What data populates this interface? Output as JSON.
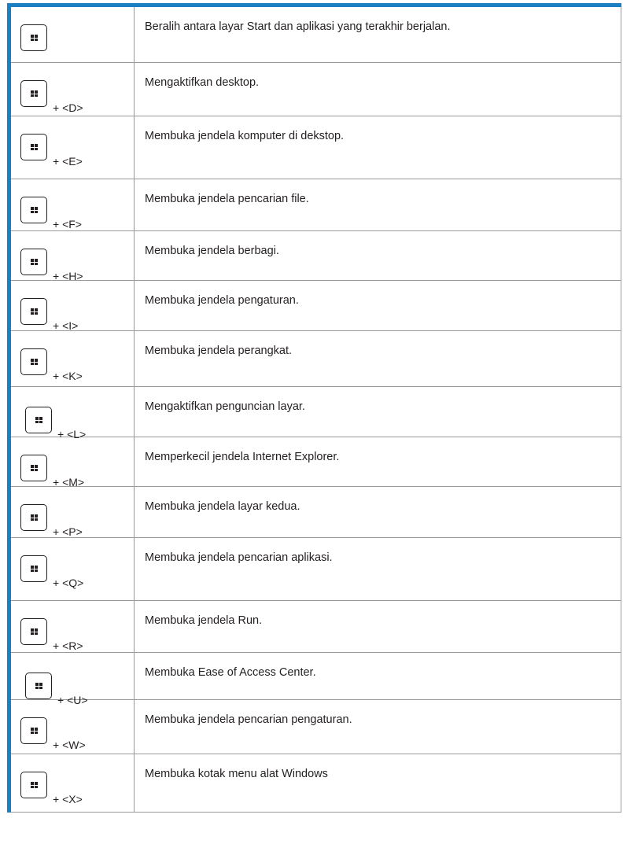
{
  "rows": [
    {
      "combo": "",
      "desc": "Beralih antara layar Start dan aplikasi yang terakhir berjalan."
    },
    {
      "combo": "+ <D>",
      "desc": "Mengaktifkan desktop."
    },
    {
      "combo": "+ <E>",
      "desc": "Membuka jendela komputer di dekstop."
    },
    {
      "combo": "+ <F>",
      "desc": "Membuka jendela pencarian file."
    },
    {
      "combo": "+ <H>",
      "desc": "Membuka jendela berbagi."
    },
    {
      "combo": "+ <I>",
      "desc": "Membuka jendela pengaturan."
    },
    {
      "combo": "+ <K>",
      "desc": "Membuka jendela perangkat."
    },
    {
      "combo": "+ <L>",
      "desc": "Mengaktifkan penguncian layar."
    },
    {
      "combo": "+ <M>",
      "desc": "Memperkecil jendela Internet Explorer."
    },
    {
      "combo": "+ <P>",
      "desc": "Membuka jendela layar kedua."
    },
    {
      "combo": "+ <Q>",
      "desc": "Membuka jendela pencarian aplikasi."
    },
    {
      "combo": "+ <R>",
      "desc": "Membuka jendela Run."
    },
    {
      "combo": "+ <U>",
      "desc": "Membuka Ease of Access Center."
    },
    {
      "combo": "+ <W>",
      "desc": "Membuka jendela pencarian pengaturan."
    },
    {
      "combo": "+ <X>",
      "desc": "Membuka kotak menu alat Windows"
    }
  ],
  "icons": {
    "key": "windows-key-icon"
  },
  "colors": {
    "accent": "#1b7fc4",
    "border": "#9a9a9a",
    "text": "#231f20"
  }
}
